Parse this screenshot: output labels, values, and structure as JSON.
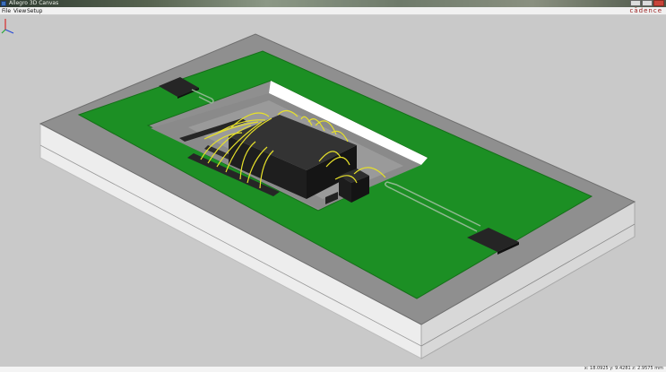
{
  "window": {
    "title": "Allegro 3D Canvas",
    "controls": [
      "minimize-icon",
      "maximize-icon",
      "close-icon"
    ]
  },
  "menu": {
    "items": [
      "File",
      "View",
      "Setup"
    ],
    "brand": "cādence"
  },
  "viewport": {
    "scene": "3D package model",
    "colors": {
      "background": "#c9c9c9",
      "substrate_top": "#8f8f8f",
      "substrate_side": "#ececec",
      "pcb_green": "#1c8f24",
      "die": "#2f2f2f",
      "bond_wire": "#e6e02a"
    }
  },
  "status": {
    "coordinates": "x: 18.0925 y: 9.4281 z: 2.9575 mm"
  }
}
